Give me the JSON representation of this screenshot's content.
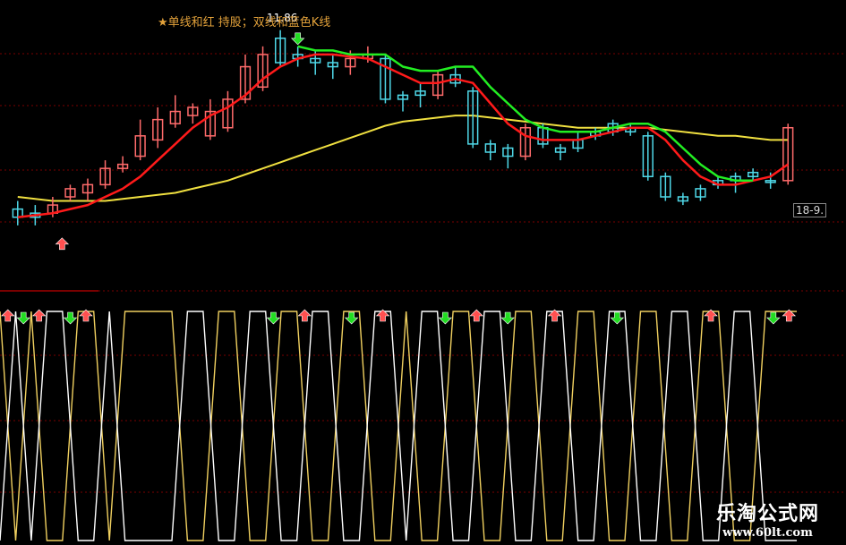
{
  "header": {
    "legend_text": "★单线和红 持股；双线和蓝色K线",
    "top_label": "11.86",
    "price_tag": "18-9."
  },
  "watermark": {
    "title": "乐淘公式网",
    "url": "www.60lt.com"
  },
  "colors": {
    "background": "#000000",
    "bull_candle": "#ff6b6b",
    "bear_candle": "#4fd8e8",
    "red_line": "#ff1a1a",
    "green_line": "#22ee22",
    "ma_line": "#f0e040",
    "grid": "#7a0000",
    "osc_yellow": "#f0d060",
    "osc_white": "#ffffff",
    "arrow_up": "#ff5050",
    "arrow_down": "#22dd22"
  },
  "chart_data": [
    {
      "type": "candlestick",
      "title": "",
      "x": [
        1,
        2,
        3,
        4,
        5,
        6,
        7,
        8,
        9,
        10,
        11,
        12,
        13,
        14,
        15,
        16,
        17,
        18,
        19,
        20,
        21,
        22,
        23,
        24,
        25,
        26,
        27,
        28,
        29,
        30,
        31,
        32,
        33,
        34,
        35,
        36,
        37,
        38,
        39,
        40,
        41,
        42,
        43,
        44,
        45
      ],
      "candles": [
        {
          "open": 12,
          "close": 16,
          "high": 20,
          "low": 8,
          "bull": false
        },
        {
          "open": 14,
          "close": 12,
          "high": 18,
          "low": 8,
          "bull": false
        },
        {
          "open": 14,
          "close": 18,
          "high": 22,
          "low": 12,
          "bull": true
        },
        {
          "open": 22,
          "close": 26,
          "high": 28,
          "low": 20,
          "bull": true
        },
        {
          "open": 24,
          "close": 28,
          "high": 31,
          "low": 20,
          "bull": true
        },
        {
          "open": 28,
          "close": 36,
          "high": 40,
          "low": 26,
          "bull": true
        },
        {
          "open": 36,
          "close": 38,
          "high": 42,
          "low": 34,
          "bull": true
        },
        {
          "open": 42,
          "close": 52,
          "high": 60,
          "low": 40,
          "bull": true
        },
        {
          "open": 50,
          "close": 60,
          "high": 66,
          "low": 46,
          "bull": true
        },
        {
          "open": 58,
          "close": 64,
          "high": 72,
          "low": 56,
          "bull": true
        },
        {
          "open": 62,
          "close": 66,
          "high": 68,
          "low": 58,
          "bull": true
        },
        {
          "open": 52,
          "close": 64,
          "high": 70,
          "low": 50,
          "bull": true
        },
        {
          "open": 56,
          "close": 70,
          "high": 74,
          "low": 54,
          "bull": true
        },
        {
          "open": 70,
          "close": 86,
          "high": 92,
          "low": 68,
          "bull": true
        },
        {
          "open": 76,
          "close": 92,
          "high": 96,
          "low": 74,
          "bull": true
        },
        {
          "open": 88,
          "close": 100,
          "high": 104,
          "low": 86,
          "bull": false
        },
        {
          "open": 92,
          "close": 90,
          "high": 96,
          "low": 86,
          "bull": false
        },
        {
          "open": 88,
          "close": 90,
          "high": 94,
          "low": 82,
          "bull": false
        },
        {
          "open": 86,
          "close": 88,
          "high": 92,
          "low": 80,
          "bull": false
        },
        {
          "open": 86,
          "close": 90,
          "high": 94,
          "low": 82,
          "bull": true
        },
        {
          "open": 92,
          "close": 90,
          "high": 96,
          "low": 88,
          "bull": true
        },
        {
          "open": 90,
          "close": 70,
          "high": 92,
          "low": 68,
          "bull": false
        },
        {
          "open": 72,
          "close": 70,
          "high": 74,
          "low": 64,
          "bull": false
        },
        {
          "open": 72,
          "close": 74,
          "high": 78,
          "low": 66,
          "bull": false
        },
        {
          "open": 72,
          "close": 82,
          "high": 84,
          "low": 70,
          "bull": true
        },
        {
          "open": 82,
          "close": 78,
          "high": 86,
          "low": 76,
          "bull": false
        },
        {
          "open": 74,
          "close": 48,
          "high": 76,
          "low": 46,
          "bull": false
        },
        {
          "open": 48,
          "close": 44,
          "high": 50,
          "low": 40,
          "bull": false
        },
        {
          "open": 46,
          "close": 42,
          "high": 48,
          "low": 36,
          "bull": false
        },
        {
          "open": 42,
          "close": 56,
          "high": 58,
          "low": 40,
          "bull": true
        },
        {
          "open": 56,
          "close": 48,
          "high": 58,
          "low": 46,
          "bull": false
        },
        {
          "open": 44,
          "close": 46,
          "high": 48,
          "low": 40,
          "bull": false
        },
        {
          "open": 46,
          "close": 50,
          "high": 54,
          "low": 44,
          "bull": false
        },
        {
          "open": 52,
          "close": 54,
          "high": 56,
          "low": 50,
          "bull": false
        },
        {
          "open": 54,
          "close": 58,
          "high": 60,
          "low": 52,
          "bull": false
        },
        {
          "open": 54,
          "close": 56,
          "high": 58,
          "low": 52,
          "bull": false
        },
        {
          "open": 52,
          "close": 32,
          "high": 54,
          "low": 30,
          "bull": false
        },
        {
          "open": 32,
          "close": 22,
          "high": 34,
          "low": 20,
          "bull": false
        },
        {
          "open": 22,
          "close": 20,
          "high": 24,
          "low": 18,
          "bull": false
        },
        {
          "open": 22,
          "close": 26,
          "high": 28,
          "low": 20,
          "bull": false
        },
        {
          "open": 28,
          "close": 30,
          "high": 32,
          "low": 26,
          "bull": false
        },
        {
          "open": 30,
          "close": 32,
          "high": 34,
          "low": 24,
          "bull": false
        },
        {
          "open": 32,
          "close": 34,
          "high": 36,
          "low": 30,
          "bull": false
        },
        {
          "open": 30,
          "close": 30,
          "high": 34,
          "low": 26,
          "bull": false
        },
        {
          "open": 30,
          "close": 56,
          "high": 58,
          "low": 28,
          "bull": true
        }
      ],
      "series": [
        {
          "color": "#ff1a1a",
          "values": [
            12,
            13,
            14,
            16,
            18,
            22,
            26,
            32,
            40,
            48,
            56,
            62,
            66,
            72,
            80,
            86,
            90,
            92,
            92,
            91,
            90,
            86,
            82,
            78,
            78,
            80,
            78,
            68,
            58,
            52,
            50,
            50,
            50,
            52,
            54,
            56,
            56,
            50,
            40,
            32,
            28,
            28,
            30,
            32,
            38
          ]
        },
        {
          "color": "#22ee22",
          "values": [
            null,
            null,
            null,
            null,
            null,
            null,
            null,
            null,
            null,
            null,
            null,
            null,
            null,
            null,
            null,
            null,
            96,
            94,
            94,
            92,
            92,
            92,
            86,
            84,
            84,
            86,
            86,
            76,
            68,
            60,
            56,
            54,
            54,
            54,
            56,
            58,
            58,
            54,
            46,
            38,
            32,
            30,
            30,
            null,
            null
          ]
        },
        {
          "color": "#f0e040",
          "values": [
            22,
            21,
            20,
            20,
            20,
            20,
            21,
            22,
            23,
            24,
            26,
            28,
            30,
            33,
            36,
            39,
            42,
            45,
            48,
            51,
            54,
            57,
            59,
            60,
            61,
            62,
            62,
            61,
            60,
            59,
            58,
            57,
            56,
            56,
            56,
            56,
            56,
            55,
            54,
            53,
            52,
            52,
            51,
            50,
            50
          ]
        }
      ],
      "markers": [
        {
          "x": 2,
          "type": "up"
        },
        {
          "x": 17,
          "type": "down"
        }
      ]
    },
    {
      "type": "line",
      "title": "",
      "ylim": [
        0,
        1
      ],
      "series": [
        {
          "color": "#f0d060",
          "values": [
            1,
            0,
            1,
            0,
            0,
            1,
            1,
            0,
            1,
            1,
            1,
            1,
            0,
            0,
            1,
            1,
            0,
            0,
            1,
            1,
            0,
            0,
            1,
            1,
            0,
            0,
            1,
            0,
            0,
            1,
            1,
            0,
            0,
            1,
            1,
            0,
            0,
            1,
            1,
            0,
            0,
            1,
            1,
            0,
            0,
            1,
            1,
            0,
            0,
            1,
            1,
            1
          ]
        },
        {
          "color": "#ffffff",
          "values": [
            0,
            1,
            0,
            1,
            1,
            0,
            0,
            1,
            0,
            0,
            0,
            0,
            1,
            1,
            0,
            0,
            1,
            1,
            0,
            0,
            1,
            1,
            0,
            0,
            1,
            1,
            0,
            1,
            1,
            0,
            0,
            1,
            1,
            0,
            0,
            1,
            1,
            0,
            0,
            1,
            1,
            0,
            0,
            1,
            1,
            0,
            0,
            1,
            1,
            0,
            0,
            0
          ]
        }
      ],
      "markers": [
        {
          "x": 0.5,
          "type": "up"
        },
        {
          "x": 1.5,
          "type": "down"
        },
        {
          "x": 2.5,
          "type": "up"
        },
        {
          "x": 4.5,
          "type": "down"
        },
        {
          "x": 5.5,
          "type": "up"
        },
        {
          "x": 17.5,
          "type": "down"
        },
        {
          "x": 19.5,
          "type": "up"
        },
        {
          "x": 22.5,
          "type": "down"
        },
        {
          "x": 24.5,
          "type": "up"
        },
        {
          "x": 28.5,
          "type": "down"
        },
        {
          "x": 30.5,
          "type": "up"
        },
        {
          "x": 32.5,
          "type": "down"
        },
        {
          "x": 35.5,
          "type": "up"
        },
        {
          "x": 39.5,
          "type": "down"
        },
        {
          "x": 45.5,
          "type": "up"
        },
        {
          "x": 49.5,
          "type": "down"
        },
        {
          "x": 50.5,
          "type": "up"
        }
      ]
    }
  ]
}
